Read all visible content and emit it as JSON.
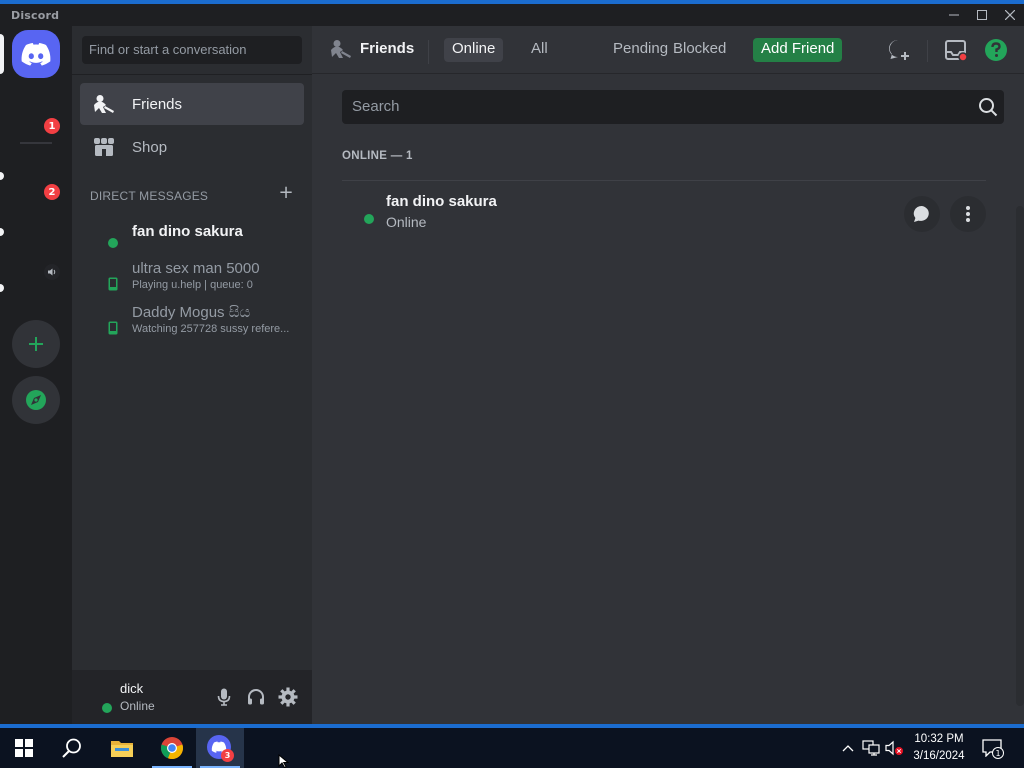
{
  "app": {
    "title": "Discord"
  },
  "window_controls": [
    "minimize-icon",
    "maximize-icon",
    "close-icon"
  ],
  "rail": {
    "badges": [
      "1",
      "2"
    ],
    "items": [
      "discord-home-icon",
      "add-server-icon",
      "explore-icon",
      "speaker-icon"
    ]
  },
  "sidebar": {
    "search_placeholder": "Find or start a conversation",
    "nav": [
      {
        "label": "Friends",
        "icon": "friends-icon"
      },
      {
        "label": "Shop",
        "icon": "shop-icon"
      }
    ],
    "dm_header": "DIRECT MESSAGES",
    "dms": [
      {
        "name": "fan dino sakura",
        "sub": "",
        "status": "online"
      },
      {
        "name": "ultra sex man 5000",
        "sub": "Playing u.help | queue: 0",
        "status": "mobile"
      },
      {
        "name": "Daddy Mogus සිය",
        "sub": "Watching 257728 sussy refere...",
        "status": "mobile"
      }
    ]
  },
  "user_panel": {
    "name": "dick",
    "status": "Online"
  },
  "header": {
    "title": "Friends",
    "tabs": [
      "Online",
      "All",
      "Pending",
      "Blocked"
    ],
    "add_friend": "Add Friend"
  },
  "main": {
    "search_placeholder": "Search",
    "online_count": "ONLINE — 1",
    "friends": [
      {
        "name": "fan dino sakura",
        "status": "Online"
      }
    ]
  },
  "taskbar": {
    "clock_time": "10:32 PM",
    "clock_date": "3/16/2024",
    "discord_badge": "3",
    "notification_badge": "1"
  },
  "colors": {
    "blurple": "#5865f2",
    "online_green": "#23a55a",
    "add_friend_green": "#248046",
    "badge_red": "#f23f43",
    "windows_blue": "#1b6ccf"
  }
}
